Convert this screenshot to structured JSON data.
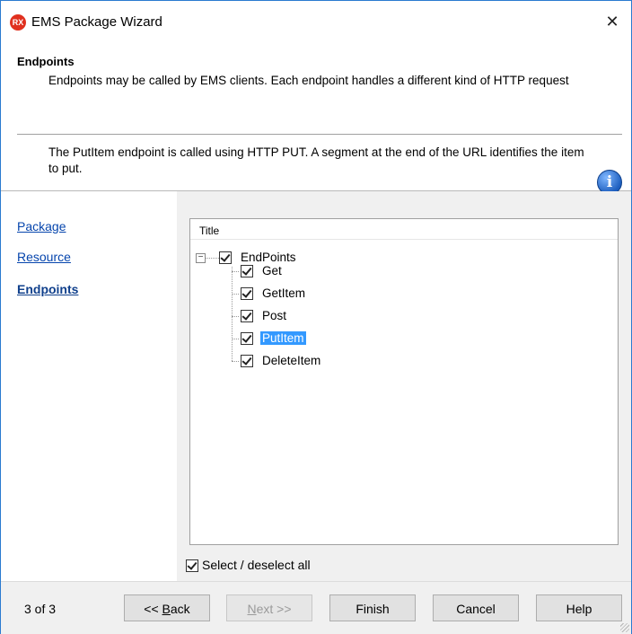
{
  "window": {
    "title": "EMS Package Wizard",
    "app_icon_text": "RX",
    "close_symbol": "✕"
  },
  "header": {
    "title": "Endpoints",
    "description": "Endpoints may be called by EMS clients.  Each endpoint handles a different kind of HTTP request",
    "endpoint_description": "The PutItem endpoint is called using HTTP PUT.  A segment at the end of the URL identifies the item to put.",
    "info_symbol": "i"
  },
  "nav": {
    "items": [
      {
        "label": "Package"
      },
      {
        "label": "Resource"
      },
      {
        "label": "Endpoints"
      }
    ]
  },
  "tree": {
    "column_title": "Title",
    "expander_symbol": "−",
    "root": {
      "label": "EndPoints",
      "checked": true
    },
    "children": [
      {
        "label": "Get",
        "checked": true
      },
      {
        "label": "GetItem",
        "checked": true
      },
      {
        "label": "Post",
        "checked": true
      },
      {
        "label": "PutItem",
        "checked": true,
        "selected": true
      },
      {
        "label": "DeleteItem",
        "checked": true
      }
    ]
  },
  "select_all": {
    "label": "Select / deselect all",
    "checked": true
  },
  "footer": {
    "step": "3 of 3",
    "back": {
      "prefix": "<< ",
      "mnemonic": "B",
      "rest": "ack"
    },
    "next": {
      "mnemonic": "N",
      "rest": "ext >>"
    },
    "finish": "Finish",
    "cancel": "Cancel",
    "help": "Help"
  },
  "colors": {
    "selection": "#3399ff",
    "link": "#0645ad",
    "window_border": "#2b7bd0"
  }
}
